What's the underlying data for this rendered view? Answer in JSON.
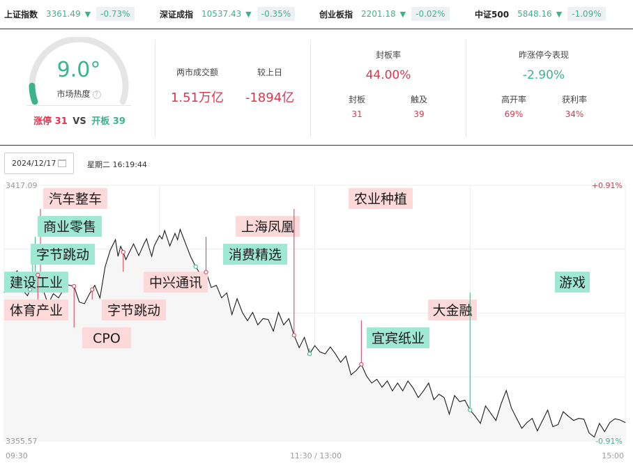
{
  "indices": [
    {
      "name": "上证指数",
      "value": "3361.49",
      "arrow": "▼",
      "change": "-0.73%"
    },
    {
      "name": "深证成指",
      "value": "10537.43",
      "arrow": "▼",
      "change": "-0.35%"
    },
    {
      "name": "创业板指",
      "value": "2201.18",
      "arrow": "▼",
      "change": "-0.02%"
    },
    {
      "name": "中证500",
      "value": "5848.16",
      "arrow": "▼",
      "change": "-1.09%"
    }
  ],
  "heat": {
    "value": "9.0°",
    "level": 0.09,
    "label": "市场热度",
    "help": "?",
    "limit_up_label": "涨停 31",
    "vs": "VS",
    "opened_label": "开板 39"
  },
  "turnover": {
    "label": "两市成交额",
    "value": "1.51万亿",
    "prev_label": "较上日",
    "prev_value": "-1894亿"
  },
  "seal": {
    "title": "封板率",
    "rate": "44.00%",
    "sealed_label": "封板",
    "sealed": "31",
    "touched_label": "触及",
    "touched": "39"
  },
  "yesterday": {
    "title": "昨涨停今表现",
    "value": "-2.90%",
    "high_open_label": "高开率",
    "high_open": "69%",
    "profit_label": "获利率",
    "profit": "34%"
  },
  "date": "2024/12/17",
  "weekday_time": "星期二 16:19:44",
  "colors": {
    "up": "#e0344e",
    "down": "#3db389",
    "up_tag": "#fdd9d9",
    "down_tag": "#9fe8d4"
  },
  "chart_data": {
    "type": "line",
    "y_max_label": "3417.09",
    "y_min_label": "3355.57",
    "pct_max_label": "+0.91%",
    "pct_min_label": "-0.91%",
    "ylim": [
      3355.57,
      3417.09
    ],
    "x_ticks": [
      "09:30",
      "11:30 / 13:00",
      "15:00"
    ],
    "total_minutes": 240,
    "series": [
      {
        "values": [
          [
            0,
            3391.3
          ],
          [
            1,
            3393.0
          ],
          [
            3,
            3395.0
          ],
          [
            5,
            3396.5
          ],
          [
            7,
            3392.0
          ],
          [
            9,
            3390.5
          ],
          [
            11,
            3393.5
          ],
          [
            13,
            3395.5
          ],
          [
            15,
            3392.0
          ],
          [
            17,
            3388.5
          ],
          [
            19,
            3391.0
          ],
          [
            21,
            3390.0
          ],
          [
            24,
            3393.2
          ],
          [
            27,
            3392.8
          ],
          [
            29,
            3389.0
          ],
          [
            31,
            3388.6
          ],
          [
            33,
            3391.0
          ],
          [
            35,
            3393.0
          ],
          [
            37,
            3390.0
          ],
          [
            39,
            3397.5
          ],
          [
            41,
            3401.5
          ],
          [
            43,
            3404.0
          ],
          [
            44,
            3400.0
          ],
          [
            45,
            3402.4
          ],
          [
            46,
            3401.0
          ],
          [
            47,
            3399.2
          ],
          [
            48,
            3400.5
          ],
          [
            50,
            3403.0
          ],
          [
            52,
            3400.2
          ],
          [
            54,
            3403.0
          ],
          [
            55,
            3404.2
          ],
          [
            56,
            3402.0
          ],
          [
            57,
            3400.0
          ],
          [
            58,
            3402.5
          ],
          [
            60,
            3405.0
          ],
          [
            61,
            3404.2
          ],
          [
            62,
            3406.2
          ],
          [
            64,
            3402.5
          ],
          [
            66,
            3405.5
          ],
          [
            67,
            3404.0
          ],
          [
            68,
            3406.5
          ],
          [
            70,
            3403.2
          ],
          [
            72,
            3400.0
          ],
          [
            74,
            3397.5
          ],
          [
            76,
            3395.5
          ],
          [
            78,
            3396.2
          ],
          [
            80,
            3392.5
          ],
          [
            82,
            3393.0
          ],
          [
            84,
            3390.0
          ],
          [
            86,
            3391.2
          ],
          [
            88,
            3386.0
          ],
          [
            90,
            3389.8
          ],
          [
            92,
            3386.5
          ],
          [
            94,
            3384.5
          ],
          [
            96,
            3386.5
          ],
          [
            98,
            3383.5
          ],
          [
            100,
            3385.0
          ],
          [
            102,
            3384.8
          ],
          [
            104,
            3382.0
          ],
          [
            106,
            3386.5
          ],
          [
            108,
            3383.5
          ],
          [
            110,
            3385.0
          ],
          [
            112,
            3381.0
          ],
          [
            114,
            3378.0
          ],
          [
            116,
            3380.5
          ],
          [
            118,
            3376.5
          ],
          [
            120,
            3378.5
          ],
          [
            122,
            3377.0
          ],
          [
            124,
            3376.5
          ],
          [
            126,
            3378.2
          ],
          [
            128,
            3376.5
          ],
          [
            130,
            3374.5
          ],
          [
            132,
            3376.0
          ],
          [
            134,
            3371.5
          ],
          [
            136,
            3372.5
          ],
          [
            138,
            3374.0
          ],
          [
            140,
            3371.2
          ],
          [
            142,
            3369.5
          ],
          [
            144,
            3370.4
          ],
          [
            146,
            3368.5
          ],
          [
            148,
            3370.0
          ],
          [
            150,
            3367.6
          ],
          [
            152,
            3369.5
          ],
          [
            154,
            3367.6
          ],
          [
            156,
            3370.0
          ],
          [
            158,
            3368.3
          ],
          [
            160,
            3366.0
          ],
          [
            162,
            3367.6
          ],
          [
            164,
            3369.5
          ],
          [
            166,
            3365.5
          ],
          [
            168,
            3366.8
          ],
          [
            170,
            3366.0
          ],
          [
            172,
            3362.0
          ],
          [
            174,
            3366.5
          ],
          [
            176,
            3365.0
          ],
          [
            178,
            3365.4
          ],
          [
            180,
            3363.0
          ],
          [
            182,
            3361.5
          ],
          [
            184,
            3359.8
          ],
          [
            186,
            3364.0
          ],
          [
            188,
            3362.2
          ],
          [
            190,
            3360.5
          ],
          [
            192,
            3364.5
          ],
          [
            194,
            3367.7
          ],
          [
            196,
            3363.5
          ],
          [
            198,
            3361.0
          ],
          [
            200,
            3358.6
          ],
          [
            202,
            3360.0
          ],
          [
            204,
            3361.0
          ],
          [
            206,
            3358.0
          ],
          [
            208,
            3360.5
          ],
          [
            210,
            3363.0
          ],
          [
            212,
            3359.0
          ],
          [
            214,
            3359.5
          ],
          [
            216,
            3362.6
          ],
          [
            218,
            3361.5
          ],
          [
            220,
            3360.5
          ],
          [
            222,
            3361.0
          ],
          [
            224,
            3360.8
          ],
          [
            226,
            3357.5
          ],
          [
            228,
            3356.5
          ],
          [
            230,
            3359.8
          ],
          [
            232,
            3357.8
          ],
          [
            234,
            3360.0
          ],
          [
            236,
            3360.9
          ],
          [
            238,
            3360.6
          ],
          [
            240,
            3360.0
          ]
        ]
      }
    ],
    "annotations": [
      {
        "label": "汽车整车",
        "kind": "up",
        "minute": 14
      },
      {
        "label": "商业零售",
        "kind": "down",
        "minute": 12
      },
      {
        "label": "字节跳动",
        "kind": "down",
        "minute": 11
      },
      {
        "label": "建设工业",
        "kind": "down",
        "minute": 10
      },
      {
        "label": "体育产业",
        "kind": "up",
        "minute": 13
      },
      {
        "label": "CPO",
        "kind": "up",
        "minute": 27
      },
      {
        "label": "字节跳动",
        "kind": "up",
        "minute": 34
      },
      {
        "label": "中兴通讯",
        "kind": "up",
        "minute": 46
      },
      {
        "label": "消费精选",
        "kind": "down",
        "minute": 74
      },
      {
        "label": "上海凤凰",
        "kind": "up",
        "minute": 78
      },
      {
        "label": "农业种植",
        "kind": "up",
        "minute": 112
      },
      {
        "label": "宜宾纸业",
        "kind": "down",
        "minute": 118
      },
      {
        "label": "大金融",
        "kind": "up",
        "minute": 138
      },
      {
        "label": "游戏",
        "kind": "down",
        "minute": 180
      }
    ]
  }
}
